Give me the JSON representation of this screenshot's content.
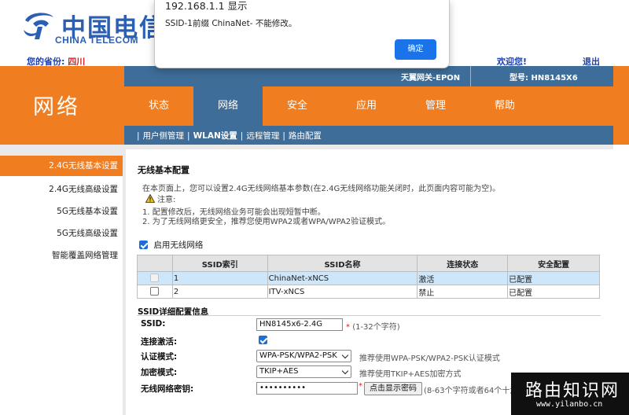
{
  "header": {
    "logo_cn": "中国电信",
    "logo_en": "CHINA TELECOM",
    "province_label": "您的省份:",
    "province_value": "四川",
    "welcome": "欢迎您!",
    "logout": "退出",
    "device_name": "天翼网关-EPON",
    "device_model": "型号: HN8145X6",
    "section_title": "网络"
  },
  "nav": {
    "tabs": [
      {
        "label": "状态"
      },
      {
        "label": "网络"
      },
      {
        "label": "安全"
      },
      {
        "label": "应用"
      },
      {
        "label": "管理"
      },
      {
        "label": "帮助"
      }
    ],
    "active_index": 1
  },
  "subnav": {
    "items": [
      {
        "label": "用户侧管理"
      },
      {
        "label": "WLAN设置"
      },
      {
        "label": "远程管理"
      },
      {
        "label": "路由配置"
      }
    ],
    "separator": "|"
  },
  "sidebar": {
    "items": [
      {
        "label": "2.4G无线基本设置"
      },
      {
        "label": "2.4G无线高级设置"
      },
      {
        "label": "5G无线基本设置"
      },
      {
        "label": "5G无线高级设置"
      },
      {
        "label": "智能覆盖网络管理"
      }
    ]
  },
  "content": {
    "heading": "无线基本配置",
    "intro": "在本页面上，您可以设置2.4G无线网络基本参数(在2.4G无线网络功能关闭时，此页面内容可能为空)。",
    "notice_label": "注意:",
    "note_1": "1. 配置修改后，无线网络业务可能会出现短暂中断。",
    "note_2": "2. 为了无线网络更安全，推荐您使用WPA2或者WPA/WPA2验证模式。",
    "enable_label": "启用无线网络",
    "table": {
      "headers": [
        "",
        "SSID索引",
        "SSID名称",
        "连接状态",
        "安全配置"
      ],
      "rows": [
        {
          "index": "1",
          "name": "ChinaNet-xNCS",
          "status": "激活",
          "security": "已配置"
        },
        {
          "index": "2",
          "name": "ITV-xNCS",
          "status": "禁止",
          "security": "已配置"
        }
      ]
    },
    "detail_heading": "SSID详细配置信息",
    "ssid_label": "SSID:",
    "ssid_value": "HN8145x6-2.4G",
    "ssid_hint": "(1-32个字符)",
    "required_mark": "*",
    "activate_label": "连接激活:",
    "auth_label": "认证模式:",
    "auth_value": "WPA-PSK/WPA2-PSK",
    "auth_hint": "推荐使用WPA-PSK/WPA2-PSK认证模式",
    "encrypt_label": "加密模式:",
    "encrypt_value": "TKIP+AES",
    "encrypt_hint": "推荐使用TKIP+AES加密方式",
    "key_label": "无线网络密钥:",
    "key_value": "••••••••••",
    "key_button": "点击显示密码",
    "key_hint": "(8-63个字符或者64个十六"
  },
  "alert": {
    "title": "192.168.1.1 显示",
    "message": "SSID-1前缀 ChinaNet- 不能修改。",
    "ok_label": "确定"
  },
  "watermark": {
    "cn": "路由知识网",
    "url": "www.yilanbo.cn"
  },
  "colors": {
    "orange": "#f07e20",
    "nav_blue": "#3d6d98",
    "brand_blue": "#2b5fb4",
    "button_blue": "#1a73e8"
  }
}
